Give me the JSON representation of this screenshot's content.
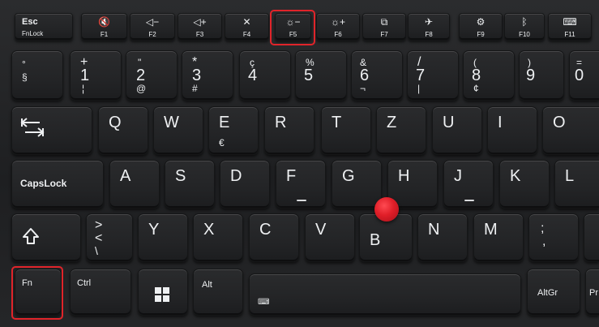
{
  "fn_row": [
    {
      "id": "esc",
      "top": "Esc",
      "bottom": "FnLock"
    },
    {
      "id": "f1",
      "icon": "mute-icon",
      "glyph": "🔇",
      "bottom": "F1"
    },
    {
      "id": "f2",
      "icon": "volume-down-icon",
      "glyph": "◁−",
      "bottom": "F2"
    },
    {
      "id": "f3",
      "icon": "volume-up-icon",
      "glyph": "◁+",
      "bottom": "F3"
    },
    {
      "id": "f4",
      "icon": "mic-mute-icon",
      "glyph": "✕",
      "bottom": "F4"
    },
    {
      "id": "f5",
      "icon": "brightness-down-icon",
      "glyph": "☼−",
      "bottom": "F5"
    },
    {
      "id": "f6",
      "icon": "brightness-up-icon",
      "glyph": "☼+",
      "bottom": "F6"
    },
    {
      "id": "f7",
      "icon": "display-switch-icon",
      "glyph": "⧉",
      "bottom": "F7"
    },
    {
      "id": "f8",
      "icon": "wireless-icon",
      "glyph": "✈",
      "bottom": "F8"
    },
    {
      "id": "f9",
      "icon": "settings-gear-icon",
      "glyph": "⚙",
      "bottom": "F9"
    },
    {
      "id": "f10",
      "icon": "bluetooth-icon",
      "glyph": "ᛒ",
      "bottom": "F10"
    },
    {
      "id": "f11",
      "icon": "keyboard-icon",
      "glyph": "⌨",
      "bottom": "F11"
    }
  ],
  "number_row": [
    {
      "id": "section",
      "top": "°",
      "bottom": "§"
    },
    {
      "id": "1",
      "top": "+",
      "bottom": "1",
      "alt": "¦"
    },
    {
      "id": "2",
      "top": "\"",
      "bottom": "2",
      "alt": "@"
    },
    {
      "id": "3",
      "top": "*",
      "bottom": "3",
      "alt": "#"
    },
    {
      "id": "4",
      "top": "ç",
      "bottom": "4"
    },
    {
      "id": "5",
      "top": "%",
      "bottom": "5"
    },
    {
      "id": "6",
      "top": "&",
      "bottom": "6",
      "alt": "¬"
    },
    {
      "id": "7",
      "top": "/",
      "bottom": "7",
      "alt": "|"
    },
    {
      "id": "8",
      "top": "(",
      "bottom": "8",
      "alt": "¢"
    },
    {
      "id": "9",
      "top": ")",
      "bottom": "9"
    },
    {
      "id": "0",
      "top": "=",
      "bottom": "0"
    }
  ],
  "q_row": [
    "Q",
    "W",
    "E",
    "R",
    "T",
    "Z",
    "U",
    "I",
    "O"
  ],
  "e_alt": "€",
  "a_row": [
    "A",
    "S",
    "D",
    "F",
    "G",
    "H",
    "J",
    "K",
    "L"
  ],
  "y_row": [
    "Y",
    "X",
    "C",
    "V",
    "B",
    "N",
    "M"
  ],
  "angle_key": {
    "top": ">",
    "bottom": "<",
    "alt": "\\"
  },
  "semicolon_key": {
    "top": ";",
    "bottom": ","
  },
  "modifiers": {
    "capslock": "CapsLock",
    "fn": "Fn",
    "ctrl": "Ctrl",
    "alt": "Alt",
    "altgr": "AltGr",
    "right_partial": "Pr"
  },
  "highlight_color": "#e0242a",
  "trackpoint_color": "#e01e28"
}
